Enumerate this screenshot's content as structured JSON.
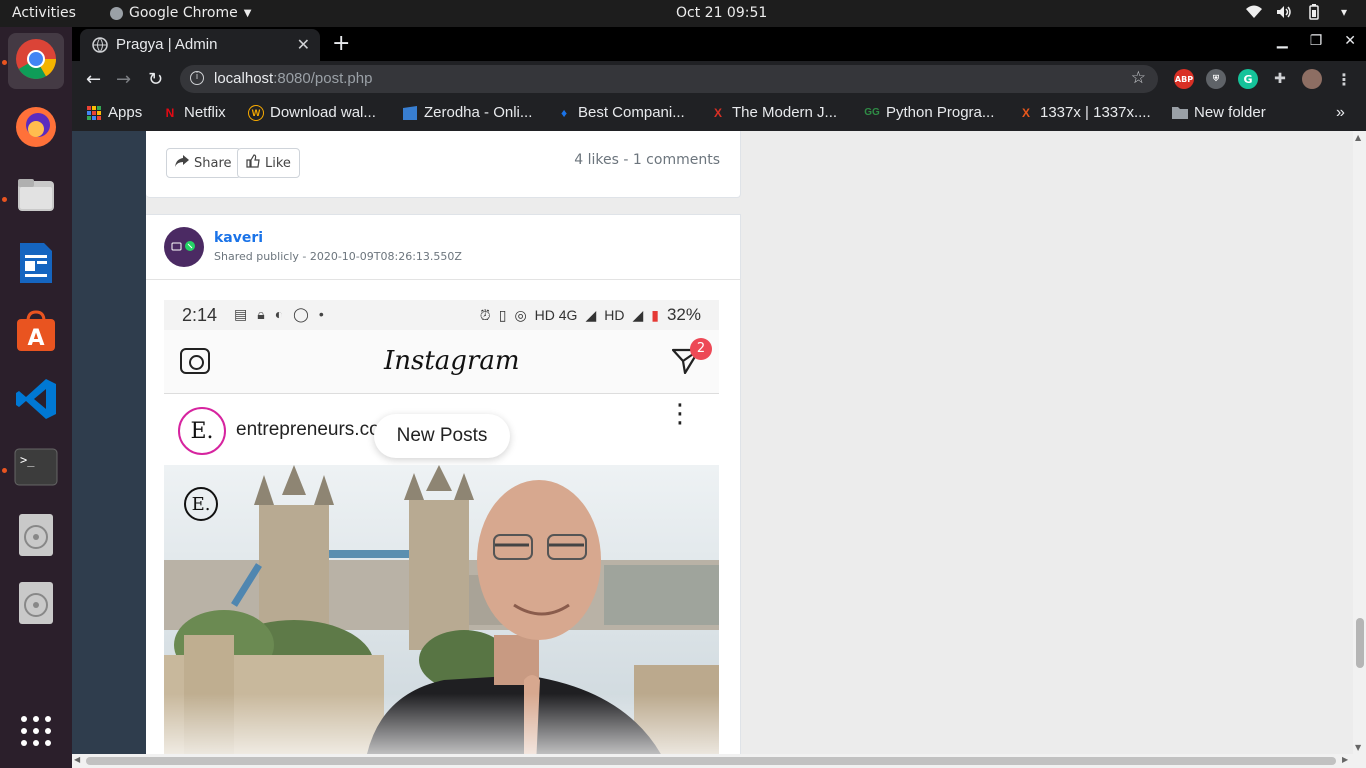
{
  "topbar": {
    "activities": "Activities",
    "app_menu": "Google Chrome",
    "clock": "Oct 21  09:51"
  },
  "dock": {
    "items": [
      "chrome-icon",
      "firefox-icon",
      "files-icon",
      "writer-icon",
      "software-icon",
      "vscode-icon",
      "terminal-icon",
      "disc-icon",
      "disc-icon",
      "apps-grid-icon"
    ]
  },
  "browser": {
    "tab_title": "Pragya | Admin",
    "url_host": "localhost",
    "url_rest": ":8080/post.php",
    "bookmarks": [
      {
        "label": "Apps",
        "icon": "apps-icon",
        "color": "#ea4335"
      },
      {
        "label": "Netflix",
        "icon": "netflix-icon",
        "color": "#e50914"
      },
      {
        "label": "Download wal...",
        "icon": "w-icon",
        "color": "#f9ab00"
      },
      {
        "label": "Zerodha - Onli...",
        "icon": "zerodha-icon",
        "color": "#387ed1"
      },
      {
        "label": "Best Compani...",
        "icon": "bestco-icon",
        "color": "#1a73e8"
      },
      {
        "label": "The Modern J...",
        "icon": "mj-icon",
        "color": "#d93025"
      },
      {
        "label": "Python Progra...",
        "icon": "gfg-icon",
        "color": "#2f8d46"
      },
      {
        "label": "1337x | 1337x....",
        "icon": "x-icon",
        "color": "#e8571b"
      },
      {
        "label": "New folder",
        "icon": "folder-icon",
        "color": "#9aa0a6"
      }
    ]
  },
  "post1": {
    "share_label": "Share",
    "like_label": "Like",
    "stats": "4 likes - 1 comments"
  },
  "post2": {
    "author": "kaveri",
    "meta": "Shared publicly - 2020-10-09T08:26:13.550Z",
    "screenshot": {
      "time": "2:14",
      "network": "HD 4G",
      "network2": "HD",
      "battery": "32%",
      "app_logo": "Instagram",
      "dm_badge": "2",
      "account": "entrepreneurs.co",
      "account_initial": "E.",
      "new_posts": "New Posts"
    }
  }
}
